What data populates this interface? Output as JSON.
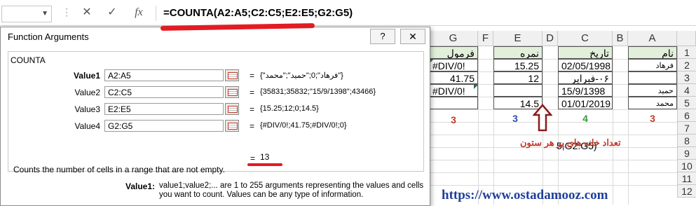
{
  "formula_bar": {
    "formula": "=COUNTA(A2:A5;C2:C5;E2:E5;G2:G5)",
    "icons": [
      "cancel-icon",
      "enter-icon",
      "insert-function-icon"
    ],
    "dots": "⋮"
  },
  "grid": {
    "columns": [
      "G",
      "F",
      "E",
      "D",
      "C",
      "B",
      "A"
    ],
    "rows": [
      "1",
      "2",
      "3",
      "4",
      "5",
      "6",
      "7",
      "8",
      "9",
      "10",
      "11",
      "12"
    ],
    "headers": {
      "G": "فرمول",
      "E": "نمره",
      "C": "تاریخ",
      "A": "نام"
    },
    "data": {
      "G2": "#DIV/0!",
      "G3": "41.75",
      "G4": "#DIV/0!",
      "E2": "15.25",
      "E3": "12",
      "E5": "14.5",
      "C2": "02/05/1998",
      "C3": "۰۶-فبرایر",
      "C4": "15/9/1398",
      "C5": "01/01/2019",
      "A2": "فرهاد",
      "A4": "حمید",
      "A5": "محمد"
    },
    "counts": {
      "G": "3",
      "E": "3",
      "C": "4",
      "A": "3"
    },
    "count_colors": {
      "G": "#c0392b",
      "E": "#2c4fb5",
      "C": "#2e9e3a",
      "A": "#c0392b"
    },
    "partial_text": "5;G2:G5)"
  },
  "dialog": {
    "title": "Function Arguments",
    "help": "?",
    "close": "✕",
    "function_name": "COUNTA",
    "args": [
      {
        "label": "Value1",
        "input": "A2:A5",
        "value": "{\"فرهاد\";0;\"حمید\";\"محمد\"}"
      },
      {
        "label": "Value2",
        "input": "C2:C5",
        "value": "{35831;35832;\"15/9/1398\";43466}"
      },
      {
        "label": "Value3",
        "input": "E2:E5",
        "value": "{15.25;12;0;14.5}"
      },
      {
        "label": "Value4",
        "input": "G2:G5",
        "value": "{#DIV/0!;41.75;#DIV/0!;0}"
      }
    ],
    "eq": "=",
    "result": "13",
    "description": "Counts the number of cells in a range that are not empty.",
    "help_label": "Value1:",
    "help_text": "value1;value2;... are 1 to 255 arguments representing the values and cells you want to count. Values can be any type of information."
  },
  "annotation": "تعداد خانه های پر هر ستون",
  "website": "https://www.ostadamooz.com",
  "colors": {
    "accent_red": "#e31b23",
    "header_green": "#e2efda",
    "site_blue": "#1f3f9c"
  }
}
